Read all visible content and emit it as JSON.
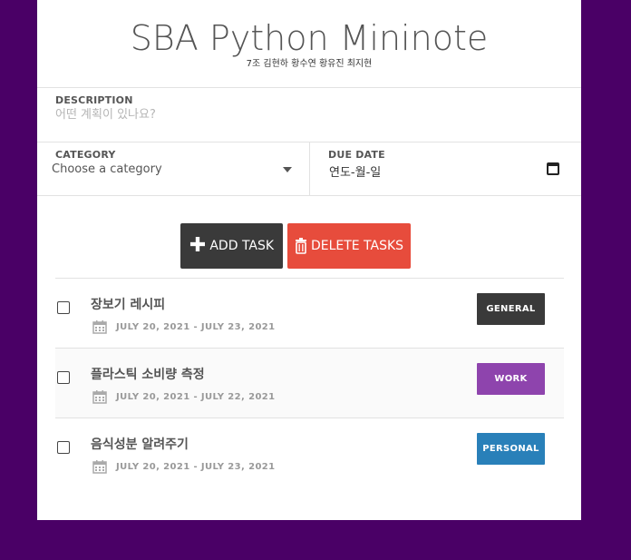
{
  "header": {
    "title": "SBA Python Mininote",
    "subtitle": "7조 김현하 황수연 황유진 최지현"
  },
  "form": {
    "description_label": "DESCRIPTION",
    "description_placeholder": "어떤 계획이 있나요?",
    "category_label": "CATEGORY",
    "category_value": "Choose a category",
    "due_date_label": "DUE DATE",
    "due_date_value": "연도-월-일"
  },
  "buttons": {
    "add_label": "ADD TASK",
    "delete_label": "DELETE TASKS"
  },
  "tasks": [
    {
      "title": "장보기 레시피",
      "date_range": "JULY 20, 2021 - JULY 23, 2021",
      "category": "GENERAL",
      "color": "#3a3a3a"
    },
    {
      "title": "플라스틱 소비량 측정",
      "date_range": "JULY 20, 2021 - JULY 22, 2021",
      "category": "WORK",
      "color": "#8e44ad"
    },
    {
      "title": "음식성분 알려주기",
      "date_range": "JULY 20, 2021 - JULY 23, 2021",
      "category": "PERSONAL",
      "color": "#2980b9"
    }
  ],
  "colors": {
    "background": "#4a0066",
    "add_button": "#3a3a3a",
    "delete_button": "#e74c3c"
  }
}
